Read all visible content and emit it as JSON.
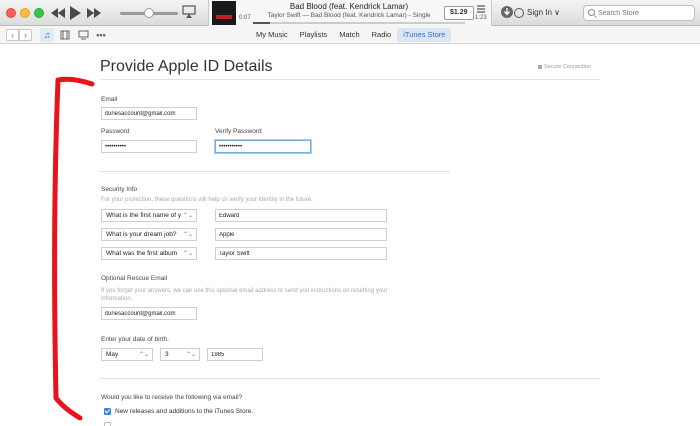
{
  "player": {
    "song_title": "Bad Blood (feat. Kendrick Lamar)",
    "song_subtitle": "Taylor Swift — Bad Blood (feat. Kendrick Lamar) - Single",
    "elapsed": "0:07",
    "remaining": "-1:23",
    "progress": 0.08,
    "volume": 0.45,
    "price": "$1.29",
    "sign_in": "Sign In",
    "search_placeholder": "Search Store"
  },
  "nav": {
    "tabs": [
      {
        "label": "My Music",
        "selected": false
      },
      {
        "label": "Playlists",
        "selected": false
      },
      {
        "label": "Match",
        "selected": false
      },
      {
        "label": "Radio",
        "selected": false
      },
      {
        "label": "iTunes Store",
        "selected": true
      }
    ]
  },
  "page": {
    "title": "Provide Apple ID Details",
    "secure": "Secure Connection"
  },
  "form": {
    "email_label": "Email",
    "email_value": "itunesaccount@gmail.com",
    "password_label": "Password",
    "password_value": "••••••••••",
    "verify_label": "Verify Password",
    "verify_value": "•••••••••••",
    "security_heading": "Security Info",
    "security_hint": "For your protection, these questions will help us verify your identity in the future.",
    "questions": [
      {
        "question": "What is the first name of y",
        "answer": "Edward"
      },
      {
        "question": "What is your dream job?",
        "answer": "Apple"
      },
      {
        "question": "What was the first album",
        "answer": "Taylor Swift"
      }
    ],
    "rescue_heading": "Optional Rescue Email",
    "rescue_hint_1": "If you forget your answers, we can use this optional email address to send you instructions on resetting your",
    "rescue_hint_2": "information.",
    "rescue_value": "itunesaccount@gmail.com",
    "dob_label": "Enter your date of birth.",
    "dob_month": "May",
    "dob_day": "3",
    "dob_year": "1985",
    "email_pref_heading": "Would you like to receive the following via email?",
    "email_pref_1": "New releases and additions to the iTunes Store."
  },
  "colors": {
    "accent": "#3b86dc",
    "annotation": "#e8141a"
  }
}
